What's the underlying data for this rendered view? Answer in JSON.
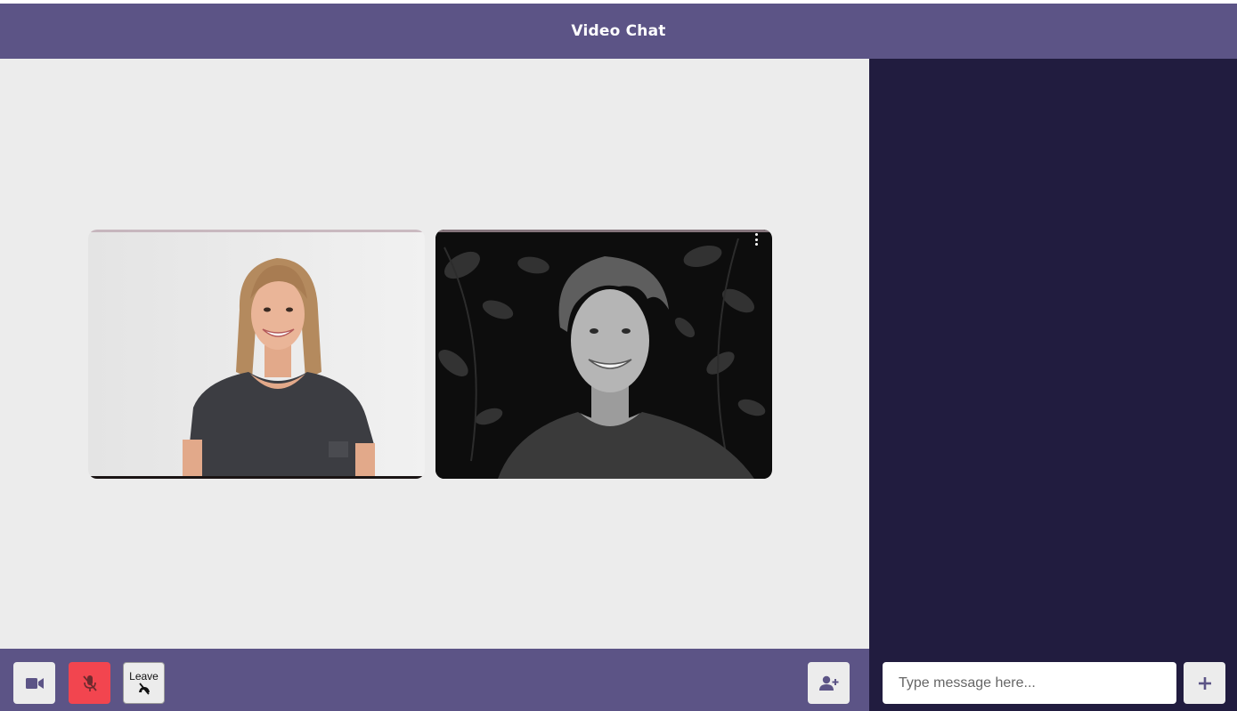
{
  "header": {
    "title": "Video Chat"
  },
  "toolbar": {
    "camera": {
      "icon": "video-camera-icon"
    },
    "mic": {
      "icon": "microphone-muted-icon",
      "state": "muted",
      "color": "#f2454f"
    },
    "leave": {
      "label": "Leave",
      "icon": "hang-up-phone-icon"
    },
    "add_user": {
      "icon": "add-user-icon"
    }
  },
  "participants": [
    {
      "tile": "participant-1",
      "video": "smiling-woman-dark-tshirt"
    },
    {
      "tile": "participant-2",
      "video": "smiling-man-black-and-white",
      "menu_icon": "more-vertical-icon"
    }
  ],
  "chat": {
    "input": {
      "placeholder": "Type message here...",
      "value": ""
    },
    "send": {
      "icon": "plus-icon"
    }
  },
  "colors": {
    "header": "#5c5486",
    "sidebar": "#211c3f",
    "stage": "#ececec",
    "mic_muted": "#f2454f"
  }
}
